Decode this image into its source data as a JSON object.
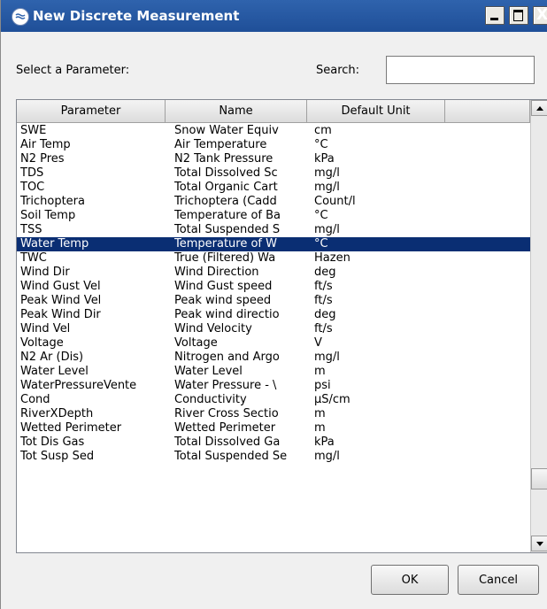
{
  "window": {
    "title": "New Discrete Measurement",
    "controls": {
      "minimize": "_",
      "maximize": "□",
      "close": "X"
    }
  },
  "form": {
    "parameter_label": "Select a Parameter:",
    "search_label": "Search:",
    "search_value": "",
    "search_placeholder": ""
  },
  "table": {
    "columns": [
      "Parameter",
      "Name",
      "Default Unit",
      ""
    ],
    "selected_index": 8,
    "rows": [
      {
        "parameter": "SWE",
        "name": "Snow Water Equiv",
        "unit": "cm"
      },
      {
        "parameter": "Air Temp",
        "name": "Air Temperature",
        "unit": "°C"
      },
      {
        "parameter": "N2 Pres",
        "name": "N2 Tank Pressure",
        "unit": "kPa"
      },
      {
        "parameter": "TDS",
        "name": "Total Dissolved Sc",
        "unit": "mg/l"
      },
      {
        "parameter": "TOC",
        "name": "Total Organic Cart",
        "unit": "mg/l"
      },
      {
        "parameter": "Trichoptera",
        "name": "Trichoptera (Cadd",
        "unit": "Count/l"
      },
      {
        "parameter": "Soil Temp",
        "name": "Temperature of Ba",
        "unit": "°C"
      },
      {
        "parameter": "TSS",
        "name": "Total Suspended S",
        "unit": "mg/l"
      },
      {
        "parameter": "Water Temp",
        "name": "Temperature of W",
        "unit": "°C"
      },
      {
        "parameter": "TWC",
        "name": "True (Filtered) Wa",
        "unit": "Hazen"
      },
      {
        "parameter": "Wind Dir",
        "name": "Wind Direction",
        "unit": "deg"
      },
      {
        "parameter": "Wind Gust Vel",
        "name": "Wind Gust speed",
        "unit": "ft/s"
      },
      {
        "parameter": "Peak Wind Vel",
        "name": "Peak wind speed",
        "unit": "ft/s"
      },
      {
        "parameter": "Peak Wind Dir",
        "name": "Peak wind directio",
        "unit": "deg"
      },
      {
        "parameter": "Wind Vel",
        "name": "Wind Velocity",
        "unit": "ft/s"
      },
      {
        "parameter": "Voltage",
        "name": "Voltage",
        "unit": "V"
      },
      {
        "parameter": "N2 Ar (Dis)",
        "name": "Nitrogen and Argo",
        "unit": "mg/l"
      },
      {
        "parameter": "Water Level",
        "name": "Water Level",
        "unit": "m"
      },
      {
        "parameter": "WaterPressureVente",
        "name": "Water Pressure - \\",
        "unit": "psi"
      },
      {
        "parameter": "Cond",
        "name": "Conductivity",
        "unit": "µS/cm"
      },
      {
        "parameter": "RiverXDepth",
        "name": "River Cross Sectio",
        "unit": "m"
      },
      {
        "parameter": "Wetted Perimeter",
        "name": "Wetted Perimeter",
        "unit": "m"
      },
      {
        "parameter": "Tot Dis Gas",
        "name": "Total Dissolved Ga",
        "unit": "kPa"
      },
      {
        "parameter": "Tot Susp Sed",
        "name": "Total Suspended Se",
        "unit": "mg/l"
      }
    ]
  },
  "buttons": {
    "ok": "OK",
    "cancel": "Cancel"
  },
  "icons": {
    "app": "water-gauge-icon",
    "scroll_up": "arrow-up-icon",
    "scroll_down": "arrow-down-icon"
  },
  "colors": {
    "titlebar": "#2f63ad",
    "selection": "#0a2e73"
  }
}
